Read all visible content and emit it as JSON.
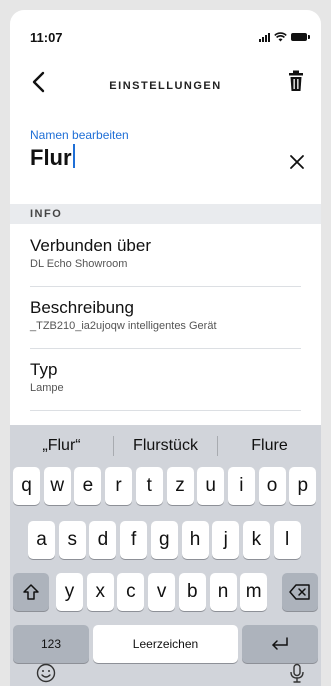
{
  "status_bar": {
    "time": "11:07"
  },
  "nav": {
    "title": "EINSTELLUNGEN"
  },
  "name_edit": {
    "label": "Namen bearbeiten",
    "value": "Flur"
  },
  "section": {
    "title": "INFO"
  },
  "rows": [
    {
      "title": "Verbunden über",
      "subtitle": "DL Echo Showroom"
    },
    {
      "title": "Beschreibung",
      "subtitle": "_TZB210_ia2ujoqw intelligentes Gerät"
    },
    {
      "title": "Typ",
      "subtitle": "Lampe"
    }
  ],
  "keyboard": {
    "suggestions": [
      "„Flur“",
      "Flurstück",
      "Flure"
    ],
    "row1": [
      "q",
      "w",
      "e",
      "r",
      "t",
      "z",
      "u",
      "i",
      "o",
      "p"
    ],
    "row2": [
      "a",
      "s",
      "d",
      "f",
      "g",
      "h",
      "j",
      "k",
      "l"
    ],
    "row3": [
      "y",
      "x",
      "c",
      "v",
      "b",
      "n",
      "m"
    ],
    "numbers_label": "123",
    "space_label": "Leerzeichen"
  },
  "icons": {
    "back": "chevron-left-icon",
    "trash": "trash-icon",
    "clear": "close-icon",
    "shift": "shift-icon",
    "delete": "backspace-icon",
    "return": "return-icon",
    "emoji": "emoji-icon",
    "mic": "microphone-icon"
  },
  "colors": {
    "accent": "#1f6fd6",
    "keyboard_bg": "#d1d4da",
    "section_bg": "#e9ebee"
  }
}
